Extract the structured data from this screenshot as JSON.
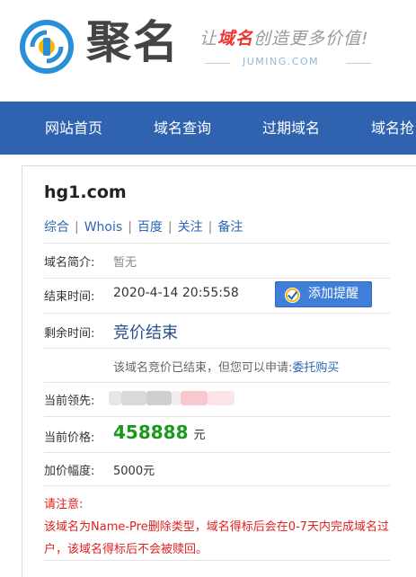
{
  "header": {
    "brand": "聚名",
    "slogan_pre": "让",
    "slogan_highlight": "域名",
    "slogan_post": "创造更多价值!",
    "url": "JUMING.COM"
  },
  "nav": {
    "items": [
      "网站首页",
      "域名查询",
      "过期域名",
      "域名抢"
    ]
  },
  "domain": {
    "name": "hg1.com",
    "links": [
      "综合",
      "Whois",
      "百度",
      "关注",
      "备注"
    ],
    "separator": "|"
  },
  "info": {
    "intro_label": "域名简介:",
    "intro_value": "暂无",
    "end_label": "结束时间:",
    "end_value": "2020-4-14 20:55:58",
    "remind_button": "添加提醒",
    "remain_label": "剩余时间:",
    "remain_value": "竞价结束",
    "apply_text": "该域名竞价已结束，但您可以申请:",
    "apply_link": "委托购买",
    "leader_label": "当前领先:",
    "price_label": "当前价格:",
    "price_value": "458888",
    "price_unit": "元",
    "increment_label": "加价幅度:",
    "increment_value": "5000元"
  },
  "notice": {
    "title": "请注意:",
    "body": "该域名为Name-Pre删除类型，域名得标后会在0-7天内完成域名过户，该域名得标后不会被赎回。"
  },
  "colors": {
    "nav_bg": "#2f63b0",
    "link": "#2a66b8",
    "price": "#1a9a1a",
    "remain": "#2a4f8f",
    "notice": "#e02020",
    "button": "#3f7fd9"
  }
}
